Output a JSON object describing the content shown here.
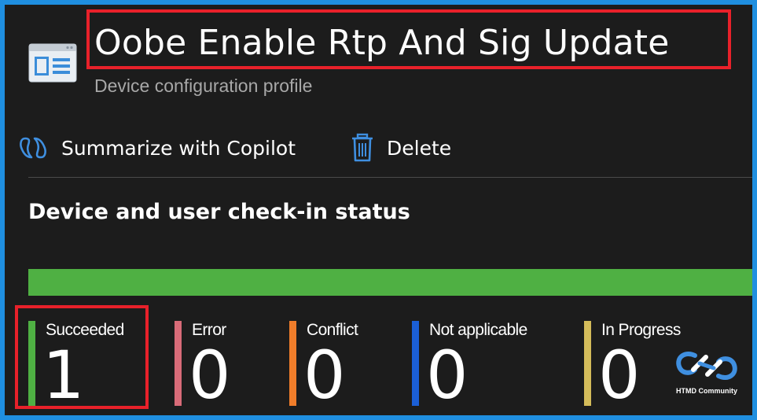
{
  "header": {
    "title": "Oobe Enable Rtp And Sig Update",
    "subtitle": "Device configuration profile",
    "icon": "profile-list-icon"
  },
  "toolbar": {
    "summarize_label": "Summarize with Copilot",
    "summarize_icon": "copilot-icon",
    "delete_label": "Delete",
    "delete_icon": "trash-icon"
  },
  "status": {
    "heading": "Device and user check-in status",
    "progress_fraction": 1.0,
    "progress_color": "#4fb043",
    "stats": [
      {
        "label": "Succeeded",
        "value": "1",
        "color": "#4fb043"
      },
      {
        "label": "Error",
        "value": "0",
        "color": "#d86b78"
      },
      {
        "label": "Conflict",
        "value": "0",
        "color": "#f07d2a"
      },
      {
        "label": "Not applicable",
        "value": "0",
        "color": "#1b5fd6"
      },
      {
        "label": "In Progress",
        "value": "0",
        "color": "#d4bc5a"
      }
    ]
  },
  "watermark": {
    "label": "HTMD Community"
  },
  "colors": {
    "highlight": "#e8212a",
    "accent": "#1f8fe0"
  }
}
